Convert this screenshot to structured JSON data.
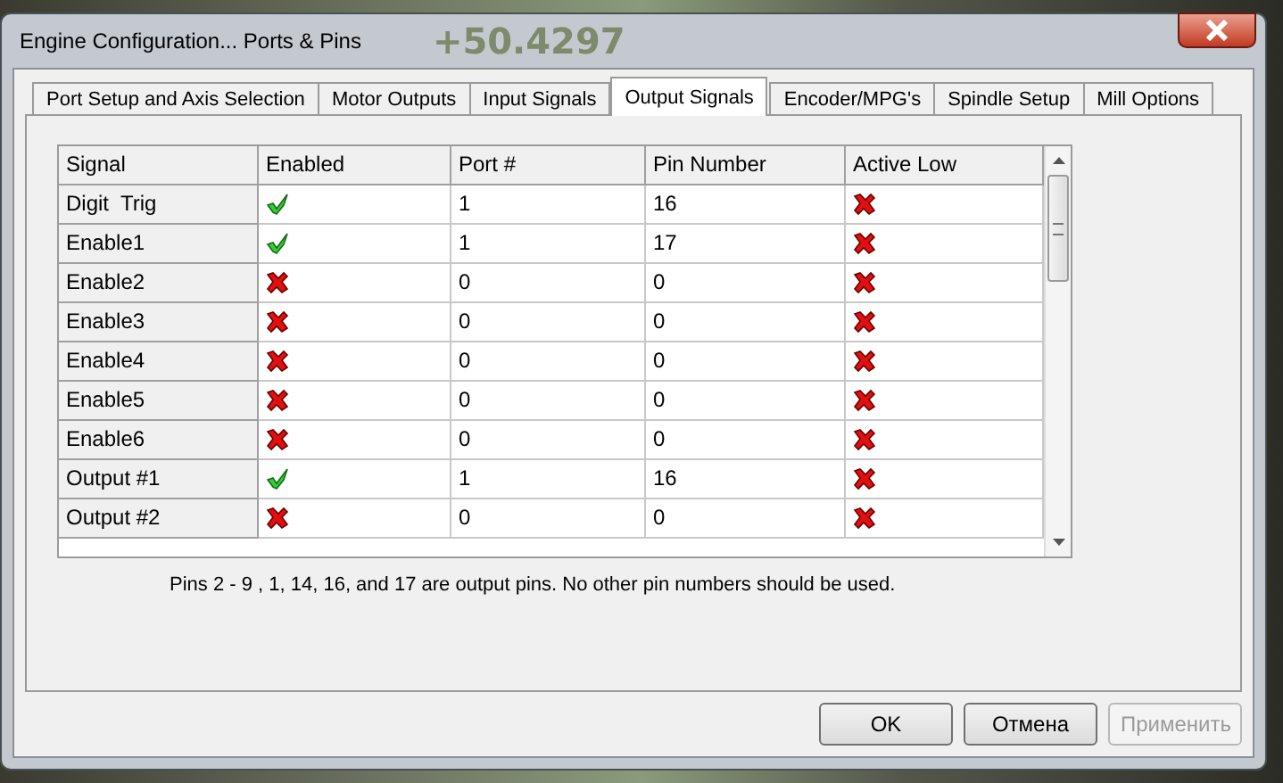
{
  "background_app": {
    "readout": "+50.4297"
  },
  "window": {
    "title": "Engine Configuration... Ports & Pins"
  },
  "tabs": [
    {
      "label": "Port Setup and Axis Selection",
      "selected": false
    },
    {
      "label": "Motor Outputs",
      "selected": false
    },
    {
      "label": "Input Signals",
      "selected": false
    },
    {
      "label": "Output Signals",
      "selected": true
    },
    {
      "label": "Encoder/MPG's",
      "selected": false
    },
    {
      "label": "Spindle Setup",
      "selected": false
    },
    {
      "label": "Mill Options",
      "selected": false
    }
  ],
  "table": {
    "columns": [
      "Signal",
      "Enabled",
      "Port #",
      "Pin Number",
      "Active Low"
    ],
    "rows": [
      {
        "signal": "Digit  Trig",
        "enabled": true,
        "port": "1",
        "pin": "16",
        "active_low": false
      },
      {
        "signal": "Enable1",
        "enabled": true,
        "port": "1",
        "pin": "17",
        "active_low": false
      },
      {
        "signal": "Enable2",
        "enabled": false,
        "port": "0",
        "pin": "0",
        "active_low": false
      },
      {
        "signal": "Enable3",
        "enabled": false,
        "port": "0",
        "pin": "0",
        "active_low": false
      },
      {
        "signal": "Enable4",
        "enabled": false,
        "port": "0",
        "pin": "0",
        "active_low": false
      },
      {
        "signal": "Enable5",
        "enabled": false,
        "port": "0",
        "pin": "0",
        "active_low": false
      },
      {
        "signal": "Enable6",
        "enabled": false,
        "port": "0",
        "pin": "0",
        "active_low": false
      },
      {
        "signal": "Output #1",
        "enabled": true,
        "port": "1",
        "pin": "16",
        "active_low": false
      },
      {
        "signal": "Output #2",
        "enabled": false,
        "port": "0",
        "pin": "0",
        "active_low": false
      }
    ]
  },
  "note": "Pins 2 - 9 , 1, 14, 16, and 17 are output pins.  No  other pin numbers should be used.",
  "buttons": [
    {
      "label": "OK",
      "disabled": false
    },
    {
      "label": "Отмена",
      "disabled": false
    },
    {
      "label": "Применить",
      "disabled": true
    }
  ]
}
